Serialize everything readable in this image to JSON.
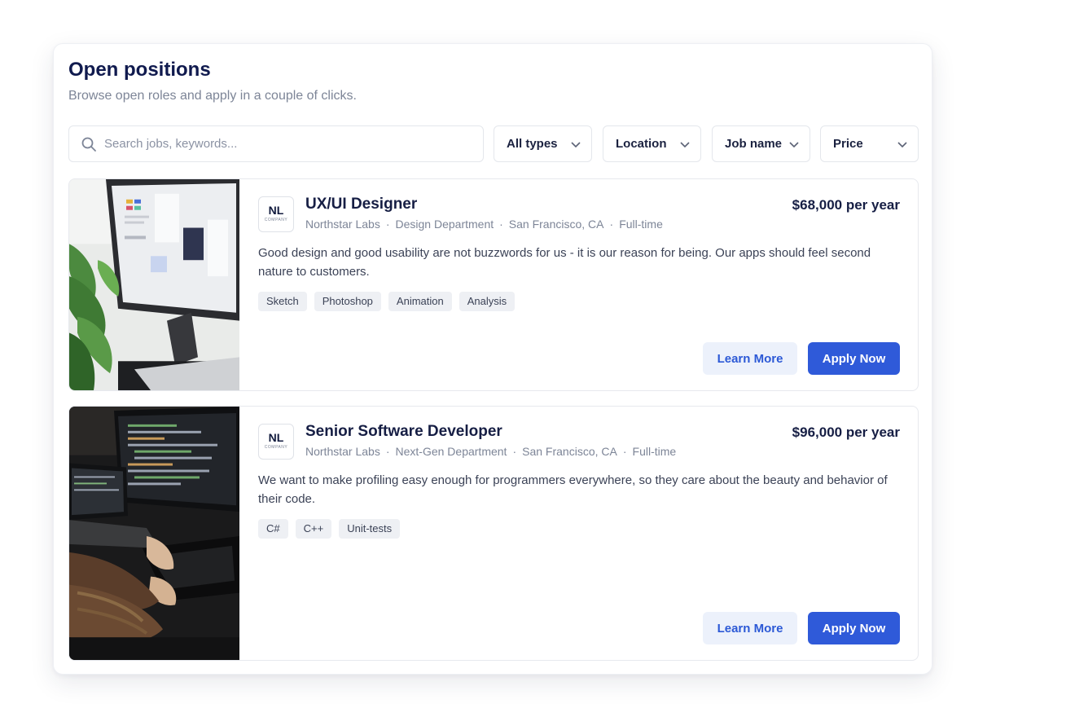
{
  "header": {
    "title": "Open positions",
    "subtitle": "Browse open roles and apply in a couple of clicks."
  },
  "search": {
    "placeholder": "Search jobs, keywords...",
    "icon": "search-icon"
  },
  "filters": [
    {
      "label": "All types",
      "icon": "chevron-down-icon"
    },
    {
      "label": "Location",
      "icon": "chevron-down-icon"
    },
    {
      "label": "Job name",
      "icon": "chevron-down-icon"
    },
    {
      "label": "Price",
      "icon": "chevron-down-icon"
    }
  ],
  "jobs": [
    {
      "image": "designer-workspace-photo",
      "logo": {
        "main": "NL",
        "sub": "COMPANY"
      },
      "title": "UX/UI Designer",
      "company": "Northstar Labs",
      "department": "Design Department",
      "location": "San Francisco, CA",
      "type": "Full-time",
      "salary": "$68,000 per year",
      "description": "Good design and good usability are not buzzwords for us - it is our reason for being. Our apps should feel second nature to customers.",
      "tags": [
        "Sketch",
        "Photoshop",
        "Animation",
        "Analysis"
      ],
      "learn_more": "Learn More",
      "apply": "Apply Now"
    },
    {
      "image": "developer-workstation-photo",
      "logo": {
        "main": "NL",
        "sub": "COMPANY"
      },
      "title": "Senior Software Developer",
      "company": "Northstar Labs",
      "department": "Next-Gen Department",
      "location": "San Francisco, CA",
      "type": "Full-time",
      "salary": "$96,000 per year",
      "description": "We want to make profiling easy enough for programmers everywhere, so they care about the beauty and behavior of their code.",
      "tags": [
        "C#",
        "C++",
        "Unit-tests"
      ],
      "learn_more": "Learn More",
      "apply": "Apply Now"
    }
  ],
  "colors": {
    "accent": "#2f5ad9",
    "accent_light": "#ecf1fb",
    "title": "#101a4e",
    "muted": "#7d8597"
  }
}
